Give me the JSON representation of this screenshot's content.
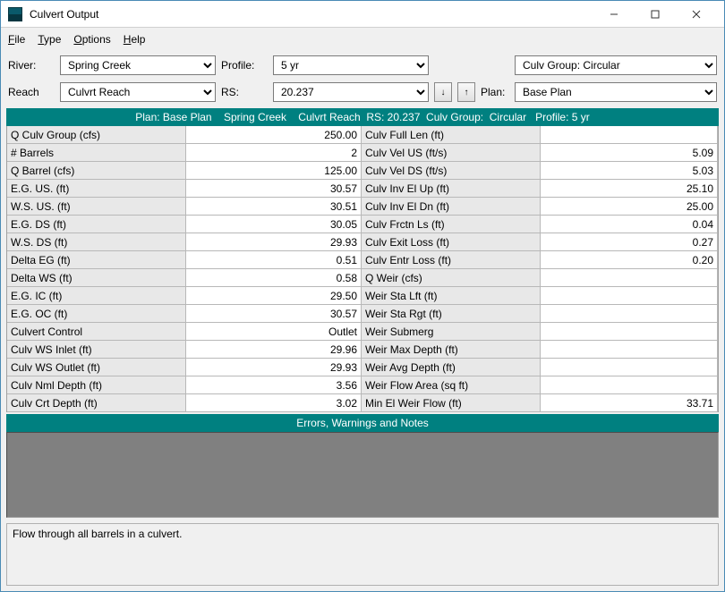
{
  "window": {
    "title": "Culvert Output"
  },
  "menubar": [
    "File",
    "Type",
    "Options",
    "Help"
  ],
  "selectors": {
    "river_lbl": "River:",
    "river_val": "Spring Creek",
    "profile_lbl": "Profile:",
    "profile_val": "5 yr",
    "culv_group_val": "Culv Group:  Circular",
    "reach_lbl": "Reach",
    "reach_val": "Culvrt Reach",
    "rs_lbl": "RS:",
    "rs_val": "20.237",
    "plan_lbl": "Plan:",
    "plan_val": "Base Plan"
  },
  "banner": "Plan: Base Plan    Spring Creek    Culvrt Reach  RS: 20.237  Culv Group:  Circular   Profile: 5 yr",
  "rows": [
    {
      "l": "Q Culv Group (cfs)",
      "v": "250.00",
      "l2": "Culv Full Len (ft)",
      "v2": ""
    },
    {
      "l": "# Barrels",
      "v": "2",
      "l2": "Culv Vel US (ft/s)",
      "v2": "5.09"
    },
    {
      "l": "Q Barrel (cfs)",
      "v": "125.00",
      "l2": "Culv Vel DS (ft/s)",
      "v2": "5.03"
    },
    {
      "l": "E.G. US. (ft)",
      "v": "30.57",
      "l2": "Culv Inv El Up (ft)",
      "v2": "25.10"
    },
    {
      "l": "W.S. US. (ft)",
      "v": "30.51",
      "l2": "Culv Inv El Dn (ft)",
      "v2": "25.00"
    },
    {
      "l": "E.G. DS (ft)",
      "v": "30.05",
      "l2": "Culv Frctn Ls (ft)",
      "v2": "0.04"
    },
    {
      "l": "W.S. DS (ft)",
      "v": "29.93",
      "l2": "Culv Exit Loss (ft)",
      "v2": "0.27"
    },
    {
      "l": "Delta EG (ft)",
      "v": "0.51",
      "l2": "Culv Entr Loss (ft)",
      "v2": "0.20"
    },
    {
      "l": "Delta WS (ft)",
      "v": "0.58",
      "l2": "Q Weir (cfs)",
      "v2": ""
    },
    {
      "l": "E.G. IC (ft)",
      "v": "29.50",
      "l2": "Weir Sta Lft (ft)",
      "v2": ""
    },
    {
      "l": "E.G. OC (ft)",
      "v": "30.57",
      "l2": "Weir Sta Rgt (ft)",
      "v2": ""
    },
    {
      "l": "Culvert Control",
      "v": "Outlet",
      "l2": "Weir Submerg",
      "v2": ""
    },
    {
      "l": "Culv WS Inlet (ft)",
      "v": "29.96",
      "l2": "Weir Max Depth (ft)",
      "v2": ""
    },
    {
      "l": "Culv WS Outlet (ft)",
      "v": "29.93",
      "l2": "Weir Avg Depth (ft)",
      "v2": ""
    },
    {
      "l": "Culv Nml Depth (ft)",
      "v": "3.56",
      "l2": "Weir Flow Area (sq ft)",
      "v2": ""
    },
    {
      "l": "Culv Crt Depth (ft)",
      "v": "3.02",
      "l2": "Min El Weir Flow (ft)",
      "v2": "33.71"
    }
  ],
  "section_hdr": "Errors, Warnings and Notes",
  "status": "Flow through all barrels in a culvert."
}
